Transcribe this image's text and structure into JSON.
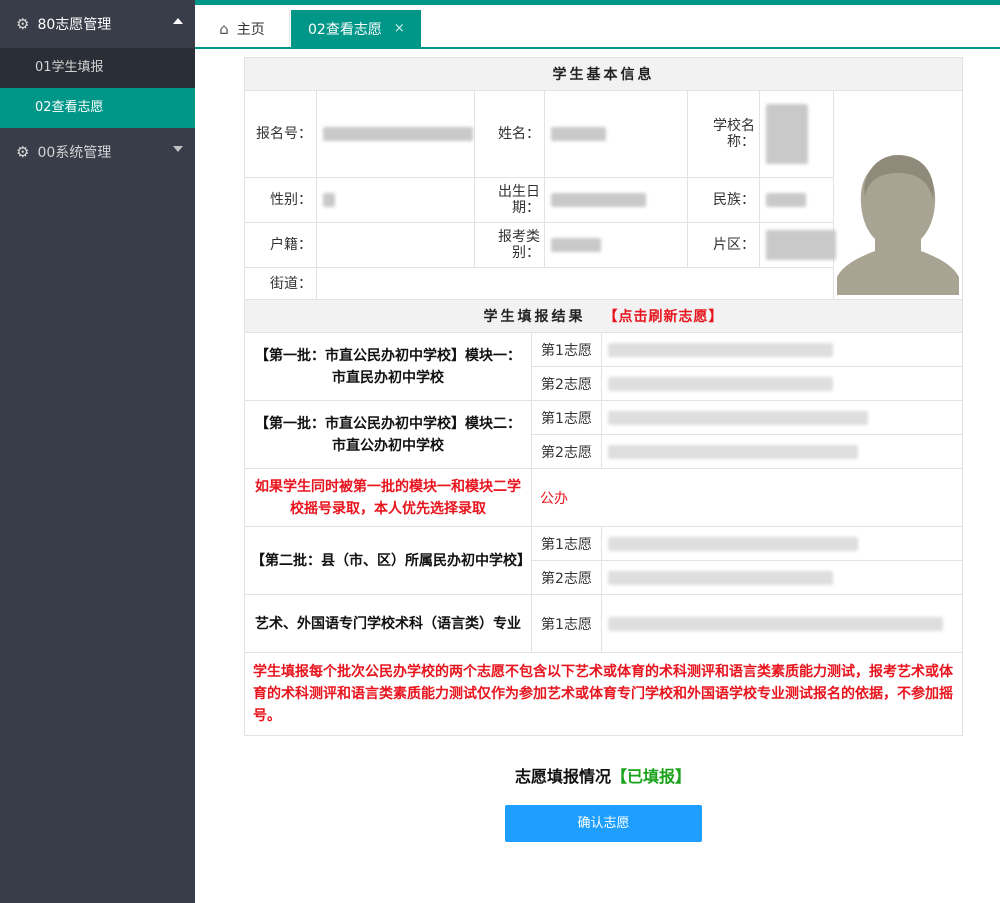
{
  "sidebar": {
    "menu1": {
      "label": "80志愿管理",
      "icon": "gear-icon"
    },
    "menu1_items": [
      {
        "label": "01学生填报"
      },
      {
        "label": "02查看志愿"
      }
    ],
    "menu2": {
      "label": "00系统管理",
      "icon": "gear-icon"
    }
  },
  "tabs": {
    "home": "主页",
    "view": "02查看志愿",
    "close": "×"
  },
  "basic_info": {
    "title": "学生基本信息",
    "reg_no_label": "报名号：",
    "name_label": "姓名：",
    "school_label": "学校名称：",
    "gender_label": "性别：",
    "birth_label": "出生日期：",
    "ethnicity_label": "民族：",
    "household_label": "户籍：",
    "category_label": "报考类别：",
    "district_label": "片区：",
    "street_label": "街道："
  },
  "results": {
    "title": "学生填报结果",
    "refresh": "【点击刷新志愿】",
    "batch1_mod1": "【第一批：市直公民办初中学校】模块一：市直民办初中学校",
    "batch1_mod2": "【第一批：市直公民办初中学校】模块二：市直公办初中学校",
    "priority_note": "如果学生同时被第一批的模块一和模块二学校摇号录取，本人优先选择录取",
    "priority_value": "公办",
    "batch2": "【第二批：县（市、区）所属民办初中学校】",
    "art": "艺术、外国语专门学校术科（语言类）专业",
    "wish1": "第1志愿",
    "wish2": "第2志愿",
    "note": "学生填报每个批次公民办学校的两个志愿不包含以下艺术或体育的术科测评和语言类素质能力测试，报考艺术或体育的术科测评和语言类素质能力测试仅作为参加艺术或体育专门学校和外国语学校专业测试报名的依据，不参加摇号。"
  },
  "status": {
    "label": "志愿填报情况",
    "value": "【已填报】"
  },
  "confirm_button": "确认志愿",
  "colors": {
    "sidebar_bg": "#393d49",
    "accent": "#009688",
    "button": "#1e9fff",
    "alert": "#e8141e",
    "success": "#1aa31a"
  }
}
